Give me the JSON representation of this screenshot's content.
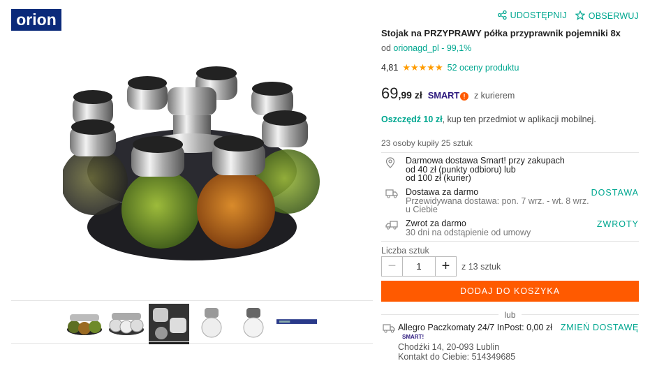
{
  "brand": {
    "logo_text": "orion",
    "logo_color": "#0b2a7a"
  },
  "header": {
    "share_label": "UDOSTĘPNIJ",
    "watch_label": "OBSERWUJ"
  },
  "product": {
    "title": "Stojak na PRZYPRAWY półka przyprawnik pojemniki 8x",
    "seller_prefix": "od",
    "seller_name": "orionagd_pl",
    "seller_rating": "- 99,1%",
    "rating_value": "4,81",
    "stars": "★★★★★",
    "reviews": "52 oceny produktu"
  },
  "price": {
    "whole": "69",
    "fraction": ",99 zł",
    "smart_text": "SMART",
    "smart_bang": "!",
    "courier": "z kurierem"
  },
  "promo": {
    "bold": "Oszczędź 10 zł",
    "rest": ", kup ten przedmiot w aplikacji mobilnej."
  },
  "buyers_text": "23 osoby kupiły 25 sztuk",
  "shipping": [
    {
      "line1": "Darmowa dostawa Smart! przy zakupach",
      "line2": "od 40 zł (punkty odbioru) lub",
      "line3": "od 100 zł (kurier)",
      "link": ""
    },
    {
      "line1": "Dostawa za darmo",
      "line2": "Przewidywana dostawa: pon. 7 wrz. - wt. 8 wrz.",
      "line3": "u Ciebie",
      "link": "DOSTAWA"
    },
    {
      "line1": "Zwrot za darmo",
      "line2": "30 dni na odstąpienie od umowy",
      "line3": "",
      "link": "ZWROTY"
    }
  ],
  "quantity": {
    "label": "Liczba sztuk",
    "value": "1",
    "minus": "−",
    "plus": "+",
    "of_text": "z 13 sztuk"
  },
  "cart_button": "DODAJ DO KOSZYKA",
  "or_text": "lub",
  "locker": {
    "name": "Allegro Paczkomaty 24/7 InPost: 0,00 zł",
    "smart_small": "SMART!",
    "address": "Chodźki 14, 20-093 Lublin",
    "contact": "Kontakt do Ciebie: 514349685",
    "change": "ZMIEŃ DOSTAWĘ"
  },
  "colors": {
    "accent": "#00a790",
    "cta": "#ff5a00",
    "star": "#ff9c00",
    "smart": "#2d1a7e"
  },
  "icons": [
    "share-icon",
    "star-outline-icon",
    "location-pin-icon",
    "truck-icon",
    "return-truck-icon",
    "parcel-truck-icon"
  ]
}
